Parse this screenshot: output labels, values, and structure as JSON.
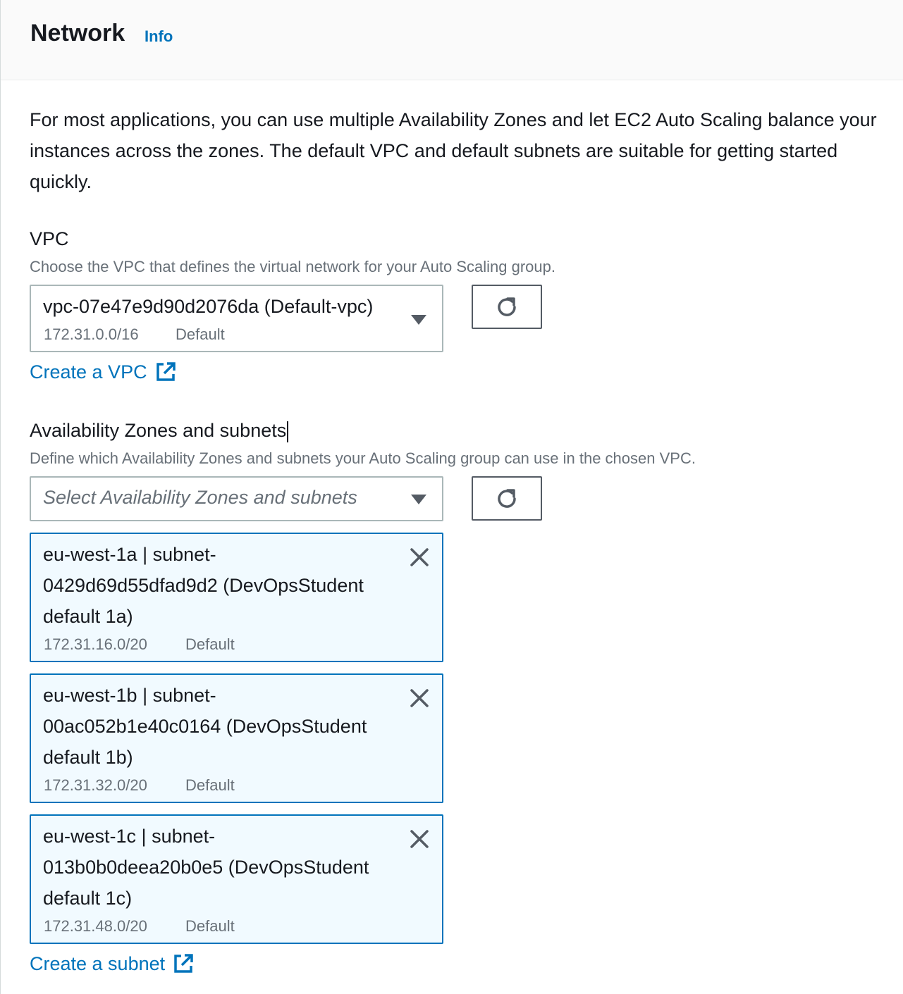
{
  "header": {
    "title": "Network",
    "info_label": "Info"
  },
  "description": "For most applications, you can use multiple Availability Zones and let EC2 Auto Scaling balance your instances across the zones. The default VPC and default subnets are suitable for getting started quickly.",
  "vpc": {
    "label": "VPC",
    "description": "Choose the VPC that defines the virtual network for your Auto Scaling group.",
    "selected_value": "vpc-07e47e9d90d2076da (Default-vpc)",
    "cidr": "172.31.0.0/16",
    "tag": "Default",
    "create_link": "Create a VPC"
  },
  "subnets": {
    "label": "Availability Zones and subnets",
    "description": "Define which Availability Zones and subnets your Auto Scaling group can use in the chosen VPC.",
    "placeholder": "Select Availability Zones and subnets",
    "selected": [
      {
        "lines": [
          "eu-west-1a | subnet-",
          "0429d69d55dfad9d2 (DevOpsStudent",
          "default 1a)"
        ],
        "cidr": "172.31.16.0/20",
        "tag": "Default"
      },
      {
        "lines": [
          "eu-west-1b | subnet-",
          "00ac052b1e40c0164 (DevOpsStudent",
          "default 1b)"
        ],
        "cidr": "172.31.32.0/20",
        "tag": "Default"
      },
      {
        "lines": [
          "eu-west-1c | subnet-",
          "013b0b0deea20b0e5 (DevOpsStudent",
          "default 1c)"
        ],
        "cidr": "172.31.48.0/20",
        "tag": "Default"
      }
    ],
    "create_link": "Create a subnet"
  },
  "icons": {
    "refresh": "refresh-icon",
    "caret": "caret-down-icon",
    "external": "external-link-icon",
    "remove": "close-icon"
  },
  "colors": {
    "link": "#0073bb",
    "token_bg": "#f1faff",
    "token_border": "#0073bb"
  }
}
